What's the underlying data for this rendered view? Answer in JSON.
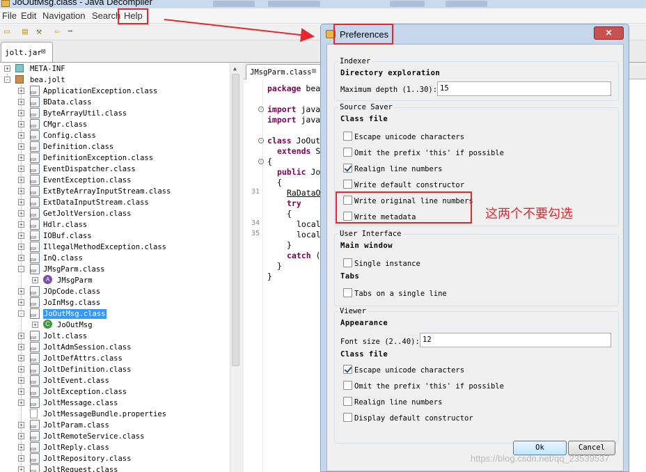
{
  "window": {
    "title": "JoOutMsg.class - Java Decompiler"
  },
  "menu": [
    "File",
    "Edit",
    "Navigation",
    "Search",
    "Help"
  ],
  "toolbar_icons": [
    "open-folder-icon",
    "open-file-icon",
    "hammer-icon",
    "back-arrow-icon",
    "forward-arrow-icon"
  ],
  "file_tab": {
    "label": "jolt.jar",
    "close": "⊠"
  },
  "tree": [
    {
      "label": "META-INF",
      "icon": "meta-folder",
      "depth": 0,
      "toggle": "+"
    },
    {
      "label": "bea.jolt",
      "icon": "package",
      "depth": 0,
      "toggle": "−"
    },
    {
      "label": "ApplicationException.class",
      "icon": "class",
      "depth": 1,
      "toggle": "+"
    },
    {
      "label": "BData.class",
      "icon": "class",
      "depth": 1,
      "toggle": "+"
    },
    {
      "label": "ByteArrayUtil.class",
      "icon": "class",
      "depth": 1,
      "toggle": "+"
    },
    {
      "label": "CMgr.class",
      "icon": "class",
      "depth": 1,
      "toggle": "+"
    },
    {
      "label": "Config.class",
      "icon": "class",
      "depth": 1,
      "toggle": "+"
    },
    {
      "label": "Definition.class",
      "icon": "class",
      "depth": 1,
      "toggle": "+"
    },
    {
      "label": "DefinitionException.class",
      "icon": "class",
      "depth": 1,
      "toggle": "+"
    },
    {
      "label": "EventDispatcher.class",
      "icon": "class",
      "depth": 1,
      "toggle": "+"
    },
    {
      "label": "EventException.class",
      "icon": "class",
      "depth": 1,
      "toggle": "+"
    },
    {
      "label": "ExtByteArrayInputStream.class",
      "icon": "class",
      "depth": 1,
      "toggle": "+"
    },
    {
      "label": "ExtDataInputStream.class",
      "icon": "class",
      "depth": 1,
      "toggle": "+"
    },
    {
      "label": "GetJoltVersion.class",
      "icon": "class",
      "depth": 1,
      "toggle": "+"
    },
    {
      "label": "Hdlr.class",
      "icon": "class",
      "depth": 1,
      "toggle": "+"
    },
    {
      "label": "IOBuf.class",
      "icon": "class",
      "depth": 1,
      "toggle": "+"
    },
    {
      "label": "IllegalMethodException.class",
      "icon": "class",
      "depth": 1,
      "toggle": "+"
    },
    {
      "label": "InQ.class",
      "icon": "class",
      "depth": 1,
      "toggle": "+"
    },
    {
      "label": "JMsgParm.class",
      "icon": "class",
      "depth": 1,
      "toggle": "−"
    },
    {
      "label": "JMsgParm",
      "icon": "abstract",
      "depth": 2,
      "toggle": "+"
    },
    {
      "label": "JOpCode.class",
      "icon": "class",
      "depth": 1,
      "toggle": "+"
    },
    {
      "label": "JoInMsg.class",
      "icon": "class",
      "depth": 1,
      "toggle": "+"
    },
    {
      "label": "JoOutMsg.class",
      "icon": "class",
      "depth": 1,
      "toggle": "−",
      "selected": true
    },
    {
      "label": "JoOutMsg",
      "icon": "concrete",
      "depth": 2,
      "toggle": "+"
    },
    {
      "label": "Jolt.class",
      "icon": "class",
      "depth": 1,
      "toggle": "+"
    },
    {
      "label": "JoltAdmSession.class",
      "icon": "class",
      "depth": 1,
      "toggle": "+"
    },
    {
      "label": "JoltDefAttrs.class",
      "icon": "class",
      "depth": 1,
      "toggle": "+"
    },
    {
      "label": "JoltDefinition.class",
      "icon": "class",
      "depth": 1,
      "toggle": "+"
    },
    {
      "label": "JoltEvent.class",
      "icon": "class",
      "depth": 1,
      "toggle": "+"
    },
    {
      "label": "JoltException.class",
      "icon": "class",
      "depth": 1,
      "toggle": "+"
    },
    {
      "label": "JoltMessage.class",
      "icon": "class",
      "depth": 1,
      "toggle": "+"
    },
    {
      "label": "JoltMessageBundle.properties",
      "icon": "file",
      "depth": 1,
      "toggle": ""
    },
    {
      "label": "JoltParam.class",
      "icon": "class",
      "depth": 1,
      "toggle": "+"
    },
    {
      "label": "JoltRemoteService.class",
      "icon": "class",
      "depth": 1,
      "toggle": "+"
    },
    {
      "label": "JoltReply.class",
      "icon": "class",
      "depth": 1,
      "toggle": "+"
    },
    {
      "label": "JoltRepository.class",
      "icon": "class",
      "depth": 1,
      "toggle": "+"
    },
    {
      "label": "JoltRequest.class",
      "icon": "class",
      "depth": 1,
      "toggle": "+"
    }
  ],
  "editor": {
    "tab": {
      "label": "JMsgParm.class",
      "close": "⊠"
    },
    "line_numbers": [
      {
        "n": "31",
        "row": 10
      },
      {
        "n": "34",
        "row": 13
      },
      {
        "n": "35",
        "row": 14
      }
    ],
    "lines": [
      {
        "row": 0,
        "indent": 0,
        "kw": "package",
        "rest": " bea"
      },
      {
        "row": 2,
        "indent": 0,
        "kw": "import",
        "rest": " java"
      },
      {
        "row": 3,
        "indent": 0,
        "kw": "import",
        "rest": " java"
      },
      {
        "row": 5,
        "indent": 0,
        "kw": "class",
        "rest": " JoOut"
      },
      {
        "row": 6,
        "indent": 1,
        "kw": "extends",
        "rest": " S"
      },
      {
        "row": 7,
        "indent": 0,
        "kw": "",
        "rest": "{"
      },
      {
        "row": 8,
        "indent": 1,
        "kw": "public",
        "rest": " Jo"
      },
      {
        "row": 9,
        "indent": 1,
        "kw": "",
        "rest": "{"
      },
      {
        "row": 10,
        "indent": 2,
        "kw": "",
        "rest": "RaDataO",
        "underline": true
      },
      {
        "row": 11,
        "indent": 2,
        "kw": "try",
        "rest": ""
      },
      {
        "row": 12,
        "indent": 2,
        "kw": "",
        "rest": "{"
      },
      {
        "row": 13,
        "indent": 3,
        "kw": "",
        "rest": "local"
      },
      {
        "row": 14,
        "indent": 3,
        "kw": "",
        "rest": "local"
      },
      {
        "row": 15,
        "indent": 2,
        "kw": "",
        "rest": "}"
      },
      {
        "row": 16,
        "indent": 2,
        "kw": "catch",
        "rest": " ("
      },
      {
        "row": 17,
        "indent": 1,
        "kw": "",
        "rest": "}"
      },
      {
        "row": 18,
        "indent": 0,
        "kw": "",
        "rest": "}"
      }
    ]
  },
  "dialog": {
    "title": "Preferences",
    "close": "✕",
    "indexer": {
      "legend": "Indexer",
      "heading": "Directory exploration",
      "depth_label": "Maximum depth (1..30):",
      "depth_value": "15"
    },
    "source_saver": {
      "legend": "Source Saver",
      "heading": "Class file",
      "options": [
        {
          "label": "Escape unicode characters",
          "checked": false
        },
        {
          "label": "Omit the prefix 'this' if possible",
          "checked": false
        },
        {
          "label": "Realign line numbers",
          "checked": true
        },
        {
          "label": "Write default constructor",
          "checked": false
        },
        {
          "label": "Write original line numbers",
          "checked": false
        },
        {
          "label": "Write metadata",
          "checked": false
        }
      ]
    },
    "user_interface": {
      "legend": "User Interface",
      "main_heading": "Main window",
      "single_instance": {
        "label": "Single instance",
        "checked": false
      },
      "tabs_heading": "Tabs",
      "tabs_single_line": {
        "label": "Tabs on a single line",
        "checked": false
      }
    },
    "viewer": {
      "legend": "Viewer",
      "appearance_heading": "Appearance",
      "font_label": "Font size (2..40):",
      "font_value": "12",
      "class_heading": "Class file",
      "options": [
        {
          "label": "Escape unicode characters",
          "checked": true
        },
        {
          "label": "Omit the prefix 'this' if possible",
          "checked": false
        },
        {
          "label": "Realign line numbers",
          "checked": false
        },
        {
          "label": "Display default constructor",
          "checked": false
        }
      ]
    },
    "ok_label": "Ok",
    "cancel_label": "Cancel"
  },
  "annotation": {
    "text": "这两个不要勾选",
    "color": "#e8262c"
  },
  "watermark": "https://blog.csdn.net/qq_23539537"
}
